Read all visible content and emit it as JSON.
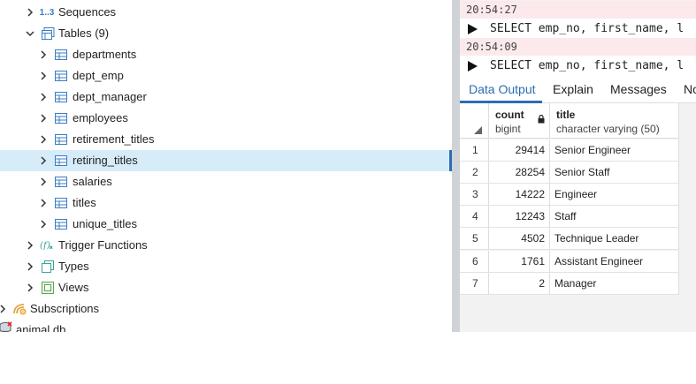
{
  "tree": {
    "items": [
      {
        "label": "Sequences",
        "prefix": "1..3",
        "icon": "sequences-icon"
      },
      {
        "label": "Tables (9)",
        "icon": "tables-icon"
      },
      {
        "label": "departments",
        "icon": "table-icon"
      },
      {
        "label": "dept_emp",
        "icon": "table-icon"
      },
      {
        "label": "dept_manager",
        "icon": "table-icon"
      },
      {
        "label": "employees",
        "icon": "table-icon"
      },
      {
        "label": "retirement_titles",
        "icon": "table-icon"
      },
      {
        "label": "retiring_titles",
        "icon": "table-icon"
      },
      {
        "label": "salaries",
        "icon": "table-icon"
      },
      {
        "label": "titles",
        "icon": "table-icon"
      },
      {
        "label": "unique_titles",
        "icon": "table-icon"
      },
      {
        "label": "Trigger Functions",
        "icon": "trigger-functions-icon"
      },
      {
        "label": "Types",
        "icon": "types-icon"
      },
      {
        "label": "Views",
        "icon": "views-icon"
      },
      {
        "label": "Subscriptions",
        "icon": "subscriptions-icon"
      },
      {
        "label": "animal.db",
        "icon": "database-icon"
      }
    ]
  },
  "messages": [
    {
      "time": "20:54:27",
      "sql": "SELECT emp_no, first_name, l"
    },
    {
      "time": "20:54:09",
      "sql": "SELECT emp_no, first_name, l"
    }
  ],
  "tabs": [
    "Data Output",
    "Explain",
    "Messages",
    "No"
  ],
  "grid": {
    "columns": [
      {
        "name": "count",
        "type": "bigint"
      },
      {
        "name": "title",
        "type": "character varying (50)"
      }
    ],
    "rows": [
      {
        "n": "1",
        "count": "29414",
        "title": "Senior Engineer"
      },
      {
        "n": "2",
        "count": "28254",
        "title": "Senior Staff"
      },
      {
        "n": "3",
        "count": "14222",
        "title": "Engineer"
      },
      {
        "n": "4",
        "count": "12243",
        "title": "Staff"
      },
      {
        "n": "5",
        "count": "4502",
        "title": "Technique Leader"
      },
      {
        "n": "6",
        "count": "1761",
        "title": "Assistant Engineer"
      },
      {
        "n": "7",
        "count": "2",
        "title": "Manager"
      }
    ]
  },
  "colors": {
    "accent": "#2a6db5",
    "selected_row": "#d6ecf8",
    "icon_blue": "#3b7dc4",
    "icon_teal": "#3aa39a"
  }
}
